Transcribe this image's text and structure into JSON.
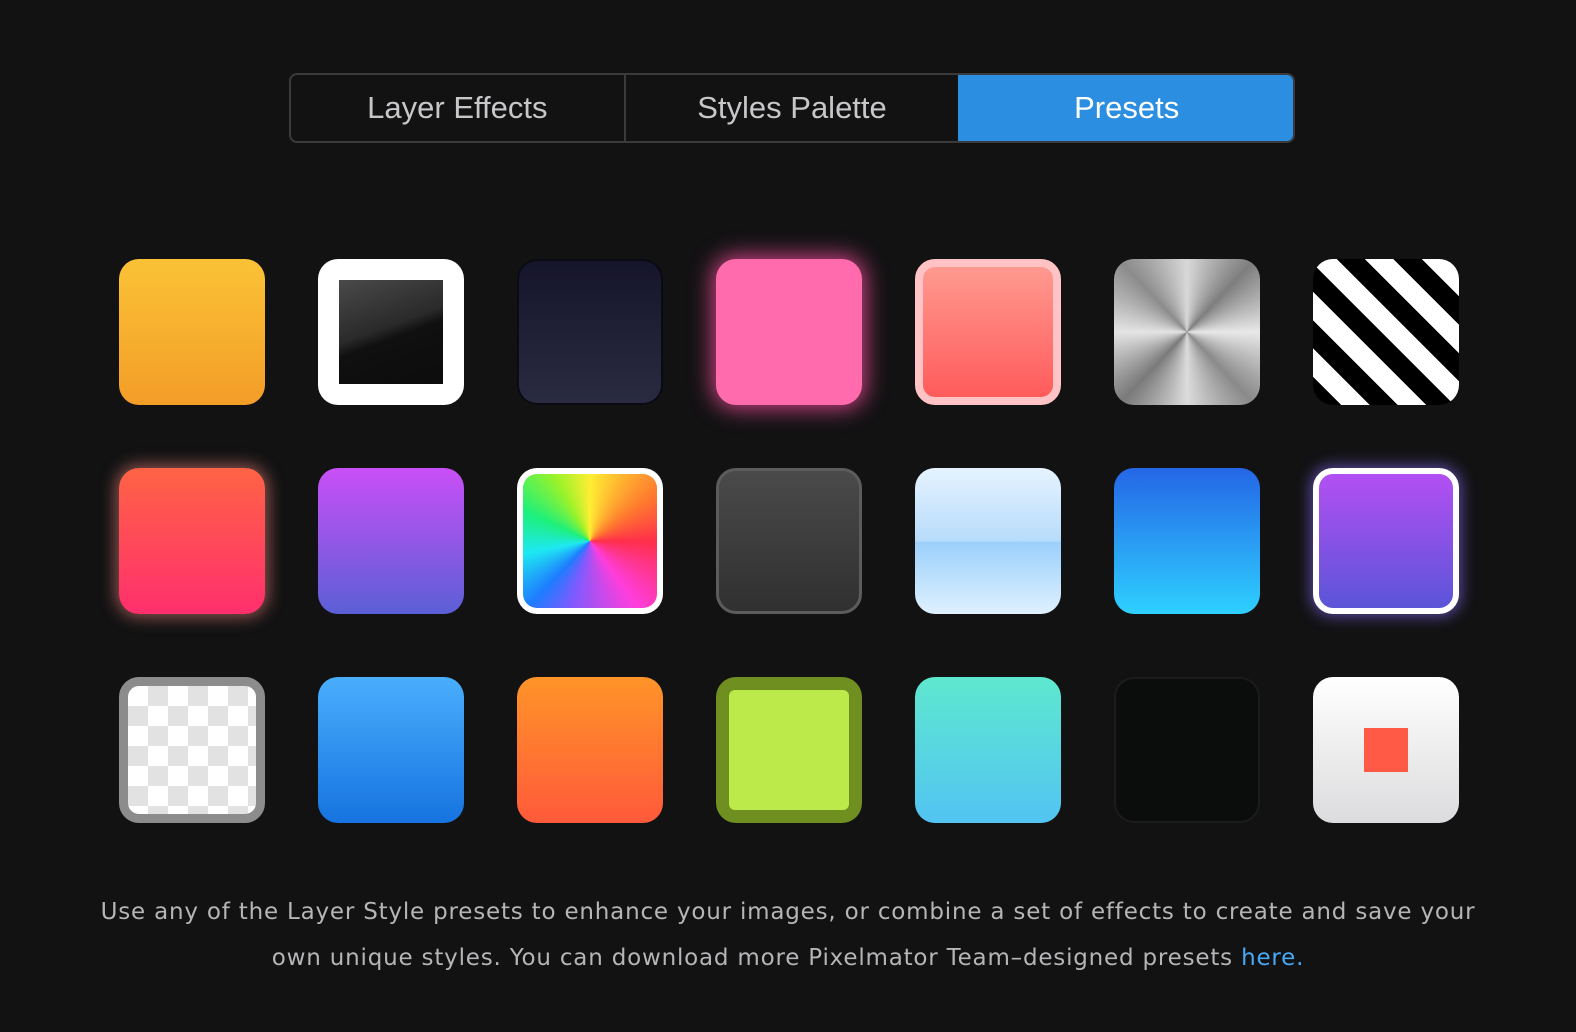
{
  "tabs": [
    {
      "label": "Layer Effects",
      "active": false
    },
    {
      "label": "Styles Palette",
      "active": false
    },
    {
      "label": "Presets",
      "active": true
    }
  ],
  "colors": {
    "background": "#121213",
    "accent": "#2b8ee0",
    "link": "#47a8f5",
    "text": "#b5b5b7"
  },
  "presets": [
    {
      "name": "yellow-orange-gradient"
    },
    {
      "name": "white-frame"
    },
    {
      "name": "dark-navy"
    },
    {
      "name": "pink-glow"
    },
    {
      "name": "coral-with-pink-border"
    },
    {
      "name": "brushed-metal"
    },
    {
      "name": "black-white-stripes"
    },
    {
      "name": "red-pink-glow"
    },
    {
      "name": "purple-gradient"
    },
    {
      "name": "rainbow-with-white-border"
    },
    {
      "name": "dark-gray-bordered"
    },
    {
      "name": "sky-blue-glass"
    },
    {
      "name": "blue-cyan-gradient"
    },
    {
      "name": "purple-with-white-border"
    },
    {
      "name": "transparency-checkerboard"
    },
    {
      "name": "blue-gradient"
    },
    {
      "name": "orange-gradient"
    },
    {
      "name": "lime-with-olive-border"
    },
    {
      "name": "teal-gradient"
    },
    {
      "name": "black"
    },
    {
      "name": "white-with-red-square"
    }
  ],
  "description": {
    "text": "Use any of the Layer Style presets to enhance your images, or combine a set of effects to create and save your own unique styles. You can download more Pixelmator Team–designed presets ",
    "link_label": "here."
  }
}
